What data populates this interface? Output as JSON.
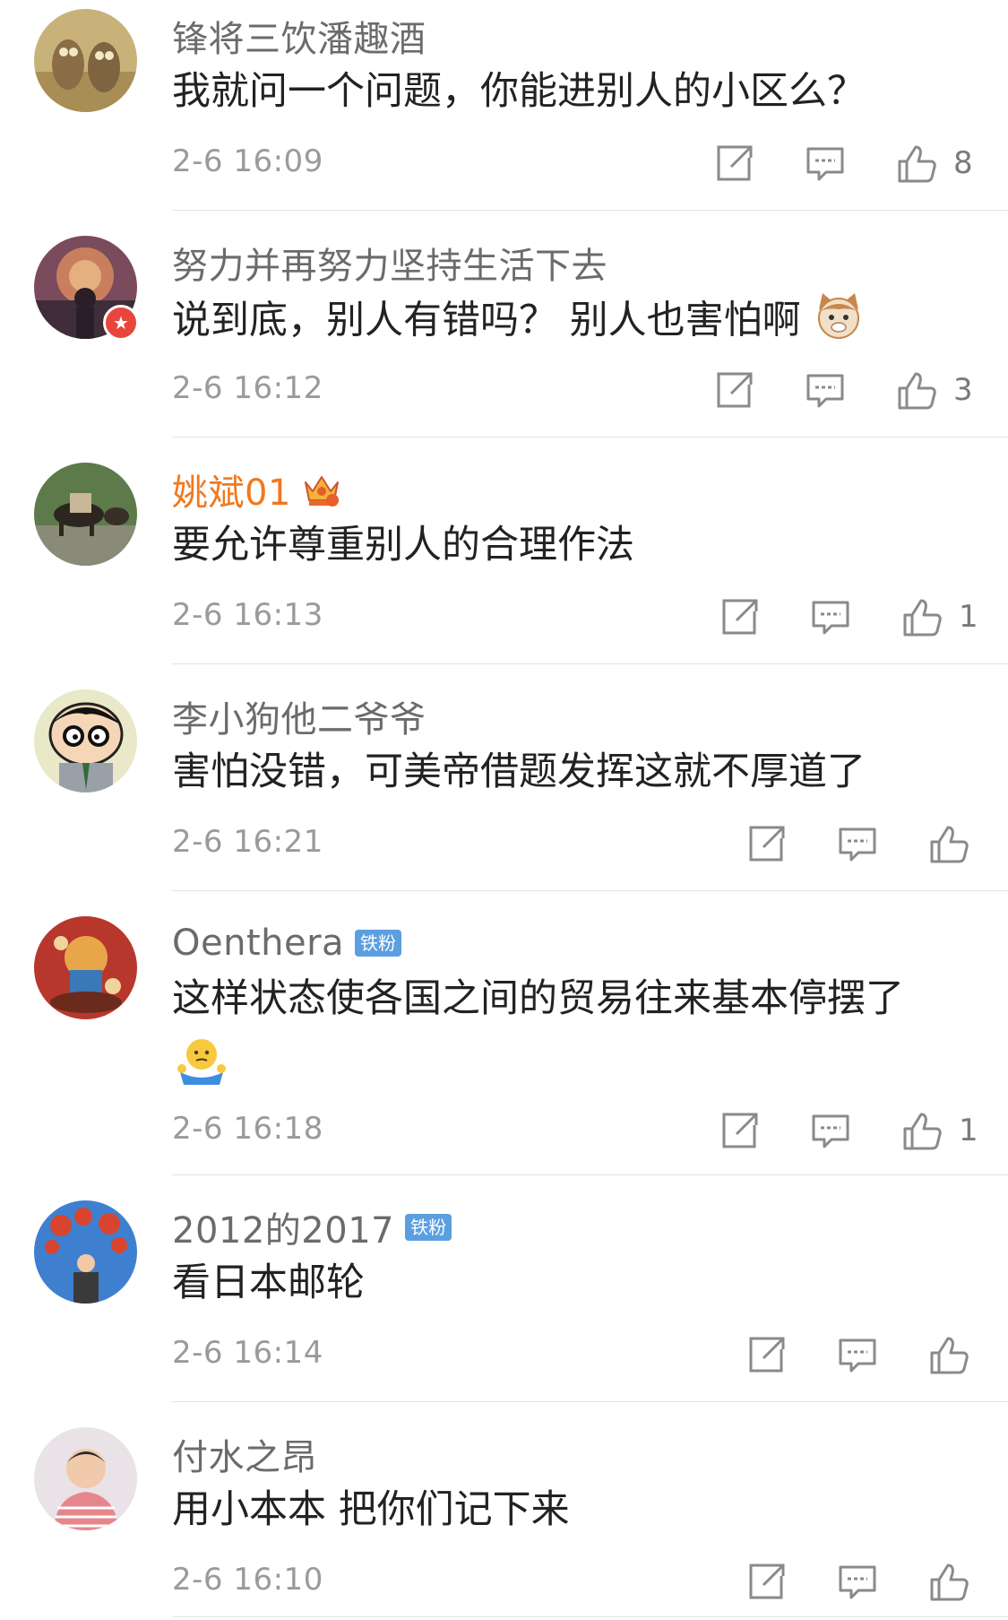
{
  "comments": [
    {
      "username": "锋将三饮潘趣酒",
      "text": "我就问一个问题，你能进别人的小区么？",
      "time": "2-6 16:09",
      "likes": "8"
    },
    {
      "username": "努力并再努力坚持生活下去",
      "text": "说到底，别人有错吗？ 别人也害怕啊",
      "time": "2-6 16:12",
      "likes": "3"
    },
    {
      "username": "姚斌01",
      "text": "要允许尊重别人的合理作法",
      "time": "2-6 16:13",
      "likes": "1"
    },
    {
      "username": "李小狗他二爷爷",
      "text": "害怕没错，可美帝借题发挥这就不厚道了",
      "time": "2-6 16:21",
      "likes": ""
    },
    {
      "username": "Oenthera",
      "badge": "铁粉",
      "text": "这样状态使各国之间的贸易往来基本停摆了",
      "time": "2-6 16:18",
      "likes": "1"
    },
    {
      "username": "2012的2017",
      "badge": "铁粉",
      "text": "看日本邮轮",
      "time": "2-6 16:14",
      "likes": ""
    },
    {
      "username": "付水之昂",
      "text": "用小本本 把你们记下来",
      "time": "2-6 16:10",
      "likes": ""
    }
  ],
  "colors": {
    "username": "#6b6b6b",
    "vip_username": "#f0791f",
    "badge_bg": "#5b9fe0",
    "time": "#9a9a9a",
    "icon": "#8a8a8a",
    "divider": "#e3e3e3"
  },
  "icons": [
    "share-icon",
    "comment-icon",
    "thumbs-up-icon"
  ]
}
